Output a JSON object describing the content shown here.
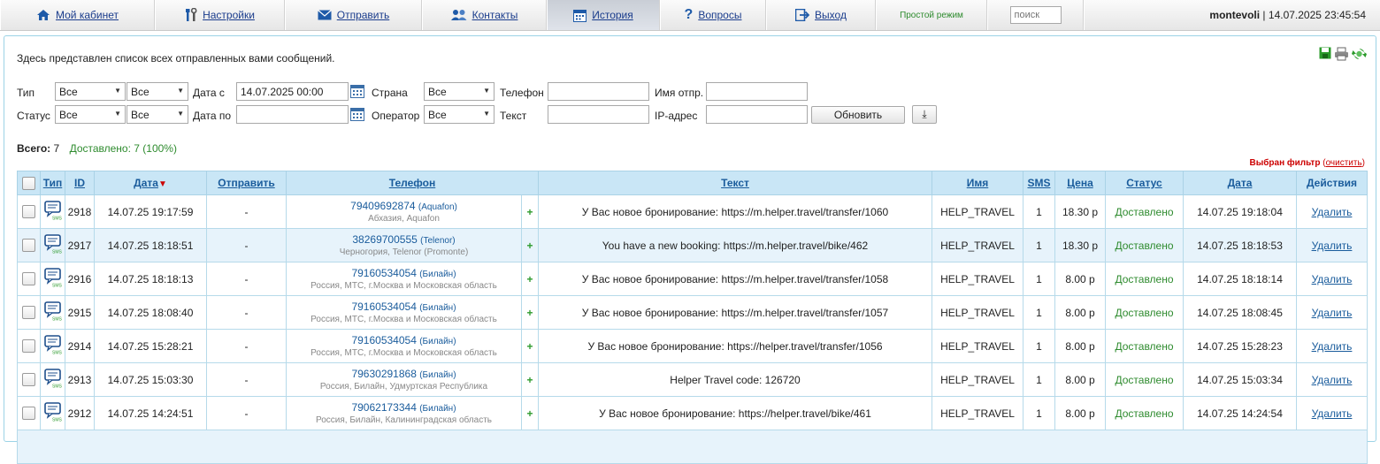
{
  "nav": {
    "items": [
      {
        "label": "Мой кабинет",
        "icon": "home-icon"
      },
      {
        "label": "Настройки",
        "icon": "tools-icon"
      },
      {
        "label": "Отправить",
        "icon": "envelope-icon"
      },
      {
        "label": "Контакты",
        "icon": "contacts-icon"
      },
      {
        "label": "История",
        "icon": "calendar-icon"
      },
      {
        "label": "Вопросы",
        "icon": "question-icon"
      },
      {
        "label": "Выход",
        "icon": "exit-icon"
      }
    ],
    "mode_label": "Простой режим",
    "search_placeholder": "поиск",
    "username": "montevoli",
    "separator": "|",
    "datetime": "14.07.2025 23:45:54"
  },
  "intro_text": "Здесь представлен список всех отправленных вами сообщений.",
  "filters": {
    "type_label": "Тип",
    "type_value1": "Все",
    "type_value2": "Все",
    "date_from_label": "Дата с",
    "date_from_value": "14.07.2025 00:00",
    "country_label": "Страна",
    "country_value": "Все",
    "phone_label": "Телефон",
    "sender_label": "Имя отпр.",
    "status_label": "Статус",
    "status_value1": "Все",
    "status_value2": "Все",
    "date_to_label": "Дата по",
    "operator_label": "Оператор",
    "operator_value": "Все",
    "text_label": "Текст",
    "ip_label": "IP-адрес",
    "refresh_label": "Обновить",
    "download_glyph": "⤓"
  },
  "totals": {
    "total_label": "Всего:",
    "total_value": "7",
    "delivered_text": "Доставлено: 7 (100%)"
  },
  "filter_note": {
    "text": "Выбран фильтр",
    "open_paren": "(",
    "clear_label": "очистить",
    "close_paren": ")"
  },
  "table": {
    "headers": {
      "type": "Тип",
      "id": "ID",
      "date": "Дата",
      "send": "Отправить",
      "phone": "Телефон",
      "text": "Текст",
      "name": "Имя",
      "sms": "SMS",
      "price": "Цена",
      "status": "Статус",
      "date2": "Дата",
      "actions": "Действия"
    },
    "sort_arrow": "▼",
    "rows": [
      {
        "id": "2918",
        "date": "14.07.25 19:17:59",
        "send": "-",
        "phone": "79409692874",
        "operator": "(Aquafon)",
        "region": "Абхазия, Aquafon",
        "plus": "+",
        "text": "У Вас новое бронирование: https://m.helper.travel/transfer/1060",
        "name": "HELP_TRAVEL",
        "sms": "1",
        "price": "18.30 р",
        "status": "Доставлено",
        "date2": "14.07.25 19:18:04",
        "action": "Удалить"
      },
      {
        "id": "2917",
        "date": "14.07.25 18:18:51",
        "send": "-",
        "phone": "38269700555",
        "operator": "(Telenor)",
        "region": "Черногория, Telenor (Promonte)",
        "plus": "+",
        "text": "You have a new booking: https://m.helper.travel/bike/462",
        "name": "HELP_TRAVEL",
        "sms": "1",
        "price": "18.30 р",
        "status": "Доставлено",
        "date2": "14.07.25 18:18:53",
        "action": "Удалить"
      },
      {
        "id": "2916",
        "date": "14.07.25 18:18:13",
        "send": "-",
        "phone": "79160534054",
        "operator": "(Билайн)",
        "region": "Россия, МТС, г.Москва и Московская область",
        "plus": "+",
        "text": "У Вас новое бронирование: https://m.helper.travel/transfer/1058",
        "name": "HELP_TRAVEL",
        "sms": "1",
        "price": "8.00 р",
        "status": "Доставлено",
        "date2": "14.07.25 18:18:14",
        "action": "Удалить"
      },
      {
        "id": "2915",
        "date": "14.07.25 18:08:40",
        "send": "-",
        "phone": "79160534054",
        "operator": "(Билайн)",
        "region": "Россия, МТС, г.Москва и Московская область",
        "plus": "+",
        "text": "У Вас новое бронирование: https://m.helper.travel/transfer/1057",
        "name": "HELP_TRAVEL",
        "sms": "1",
        "price": "8.00 р",
        "status": "Доставлено",
        "date2": "14.07.25 18:08:45",
        "action": "Удалить"
      },
      {
        "id": "2914",
        "date": "14.07.25 15:28:21",
        "send": "-",
        "phone": "79160534054",
        "operator": "(Билайн)",
        "region": "Россия, МТС, г.Москва и Московская область",
        "plus": "+",
        "text": "У Вас новое бронирование: https://helper.travel/transfer/1056",
        "name": "HELP_TRAVEL",
        "sms": "1",
        "price": "8.00 р",
        "status": "Доставлено",
        "date2": "14.07.25 15:28:23",
        "action": "Удалить"
      },
      {
        "id": "2913",
        "date": "14.07.25 15:03:30",
        "send": "-",
        "phone": "79630291868",
        "operator": "(Билайн)",
        "region": "Россия, Билайн, Удмуртская Республика",
        "plus": "+",
        "text": "Helper Travel code: 126720",
        "name": "HELP_TRAVEL",
        "sms": "1",
        "price": "8.00 р",
        "status": "Доставлено",
        "date2": "14.07.25 15:03:34",
        "action": "Удалить"
      },
      {
        "id": "2912",
        "date": "14.07.25 14:24:51",
        "send": "-",
        "phone": "79062173344",
        "operator": "(Билайн)",
        "region": "Россия, Билайн, Калининградская область",
        "plus": "+",
        "text": "У Вас новое бронирование: https://helper.travel/bike/461",
        "name": "HELP_TRAVEL",
        "sms": "1",
        "price": "8.00 р",
        "status": "Доставлено",
        "date2": "14.07.25 14:24:54",
        "action": "Удалить"
      }
    ]
  },
  "colors": {
    "link": "#1a5c9c",
    "delivered": "#2e8b2e",
    "header_bg": "#c9e6f6",
    "highlight_row": "#e7f3fb",
    "filter_red": "#cc0000"
  }
}
